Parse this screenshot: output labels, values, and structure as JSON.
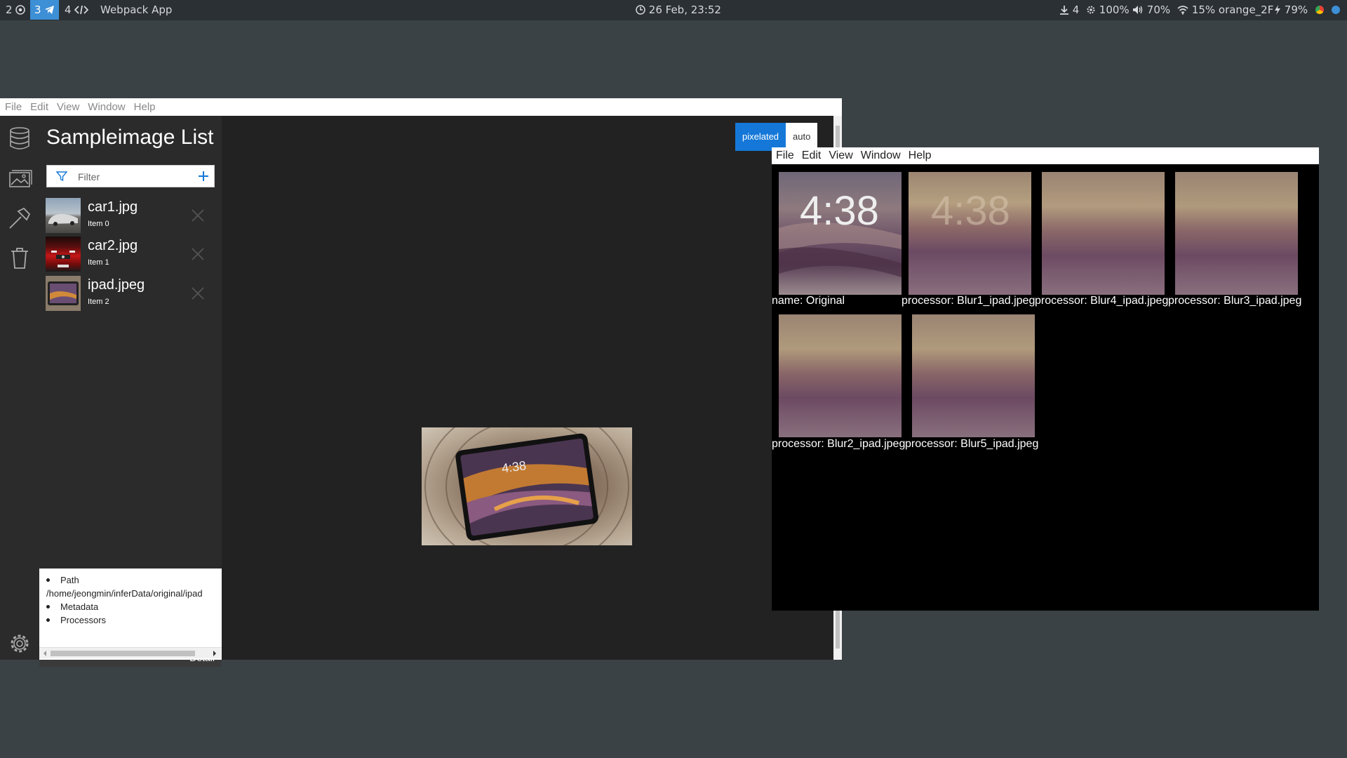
{
  "topbar": {
    "workspaces": [
      {
        "num": "2",
        "icon": "chrome-icon",
        "active": false
      },
      {
        "num": "3",
        "icon": "telegram-icon",
        "active": true
      },
      {
        "num": "4",
        "icon": "code-icon",
        "active": false
      }
    ],
    "window_title": "Webpack App",
    "clock": "26 Feb, 23:52",
    "downloads": "4",
    "brightness": "100%",
    "volume": "70%",
    "wifi": "15% orange_2F",
    "battery": "79%"
  },
  "app": {
    "menu": [
      "File",
      "Edit",
      "View",
      "Window",
      "Help"
    ],
    "sidebar_title": "Sampleimage List",
    "filter_placeholder": "Filter",
    "items": [
      {
        "name": "car1.jpg",
        "sub": "Item 0"
      },
      {
        "name": "car2.jpg",
        "sub": "Item 1"
      },
      {
        "name": "ipad.jpeg",
        "sub": "Item 2"
      }
    ],
    "detail_label": "Detail",
    "detail": {
      "path_label": "Path",
      "path_value": "/home/jeongmin/inferData/original/ipad",
      "metadata_label": "Metadata",
      "processors_label": "Processors"
    },
    "toggle": {
      "selected": "pixelated",
      "other": "auto"
    },
    "preview_clock": "4:38"
  },
  "processor_window": {
    "menu": [
      "File",
      "Edit",
      "View",
      "Window",
      "Help"
    ],
    "tiles": [
      {
        "caption": "name: Original",
        "text": "4:38"
      },
      {
        "caption": "processor: Blur1_ipad.jpeg",
        "text": "4:38"
      },
      {
        "caption": "processor: Blur4_ipad.jpeg",
        "text": ""
      },
      {
        "caption": "processor: Blur3_ipad.jpeg",
        "text": ""
      },
      {
        "caption": "processor: Blur2_ipad.jpeg",
        "text": ""
      },
      {
        "caption": "processor: Blur5_ipad.jpeg",
        "text": ""
      }
    ]
  },
  "colors": {
    "desktop": "#3b4246",
    "accent": "#1578d8",
    "window_bg": "#222222"
  }
}
